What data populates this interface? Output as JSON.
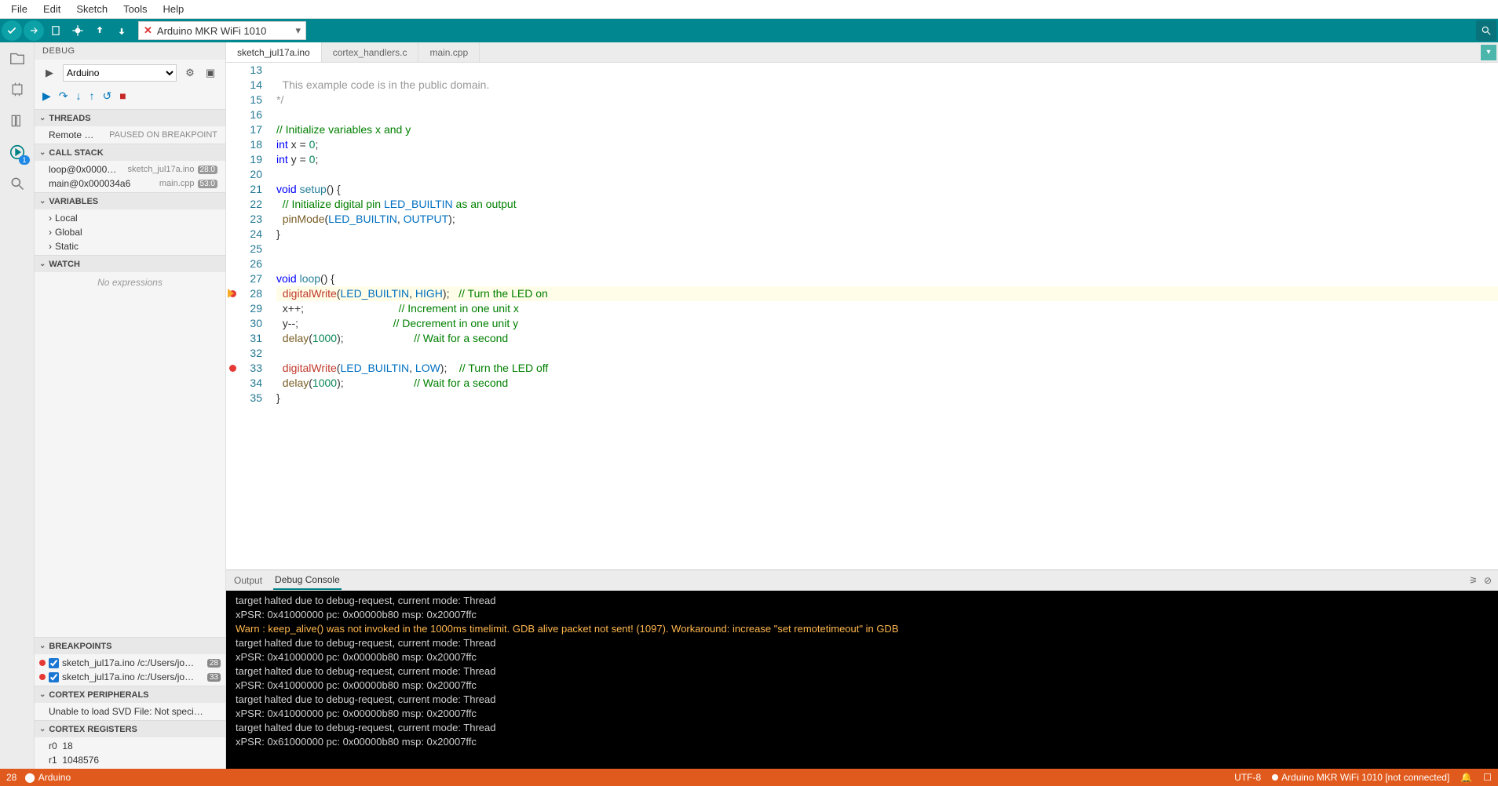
{
  "menu": {
    "items": [
      "File",
      "Edit",
      "Sketch",
      "Tools",
      "Help"
    ]
  },
  "toolbar": {
    "board": "Arduino MKR WiFi 1010"
  },
  "sidepanel": {
    "title": "DEBUG",
    "config": "Arduino",
    "threads": {
      "title": "THREADS",
      "name": "Remote …",
      "state": "PAUSED ON BREAKPOINT"
    },
    "callstack": {
      "title": "CALL STACK",
      "frames": [
        {
          "fn": "loop@0x0000…",
          "file": "sketch_jul17a.ino",
          "loc": "28:0"
        },
        {
          "fn": "main@0x000034a6",
          "file": "main.cpp",
          "loc": "53:0"
        }
      ]
    },
    "variables": {
      "title": "VARIABLES",
      "groups": [
        "Local",
        "Global",
        "Static"
      ]
    },
    "watch": {
      "title": "WATCH",
      "empty": "No expressions"
    },
    "breakpoints": {
      "title": "BREAKPOINTS",
      "items": [
        {
          "file": "sketch_jul17a.ino",
          "path": "/c:/Users/jo…",
          "line": 28
        },
        {
          "file": "sketch_jul17a.ino",
          "path": "/c:/Users/jo…",
          "line": 33
        }
      ]
    },
    "cortex_periph": {
      "title": "CORTEX PERIPHERALS",
      "msg": "Unable to load SVD File: Not speci…"
    },
    "cortex_regs": {
      "title": "CORTEX REGISTERS",
      "regs": [
        {
          "name": "r0",
          "value": "18"
        },
        {
          "name": "r1",
          "value": "1048576"
        }
      ]
    }
  },
  "tabs": [
    "sketch_jul17a.ino",
    "cortex_handlers.c",
    "main.cpp"
  ],
  "editor": {
    "first_line": 13,
    "current_line": 28,
    "breakpoints": [
      28,
      33
    ],
    "lines": [
      "",
      "  This example code is in the public domain.",
      "*/",
      "",
      "// Initialize variables x and y",
      "int x = 0;",
      "int y = 0;",
      "",
      "void setup() {",
      "  // Initialize digital pin LED_BUILTIN as an output",
      "  pinMode(LED_BUILTIN, OUTPUT);",
      "}",
      "",
      "",
      "void loop() {",
      "  digitalWrite(LED_BUILTIN, HIGH);   // Turn the LED on",
      "  x++;                               // Increment in one unit x",
      "  y--;                               // Decrement in one unit y",
      "  delay(1000);                       // Wait for a second",
      "",
      "  digitalWrite(LED_BUILTIN, LOW);    // Turn the LED off",
      "  delay(1000);                       // Wait for a second",
      "}"
    ]
  },
  "console": {
    "tabs": [
      "Output",
      "Debug Console"
    ],
    "lines": [
      "target halted due to debug-request, current mode: Thread",
      "xPSR: 0x41000000 pc: 0x00000b80 msp: 0x20007ffc",
      "Warn : keep_alive() was not invoked in the 1000ms timelimit. GDB alive packet not sent! (1097). Workaround: increase \"set remotetimeout\" in GDB",
      "target halted due to debug-request, current mode: Thread",
      "xPSR: 0x41000000 pc: 0x00000b80 msp: 0x20007ffc",
      "target halted due to debug-request, current mode: Thread",
      "xPSR: 0x41000000 pc: 0x00000b80 msp: 0x20007ffc",
      "target halted due to debug-request, current mode: Thread",
      "xPSR: 0x41000000 pc: 0x00000b80 msp: 0x20007ffc",
      "target halted due to debug-request, current mode: Thread",
      "xPSR: 0x61000000 pc: 0x00000b80 msp: 0x20007ffc"
    ]
  },
  "status": {
    "line": "28",
    "lang": "Arduino",
    "encoding": "UTF-8",
    "board": "Arduino MKR WiFi 1010 [not connected]"
  }
}
